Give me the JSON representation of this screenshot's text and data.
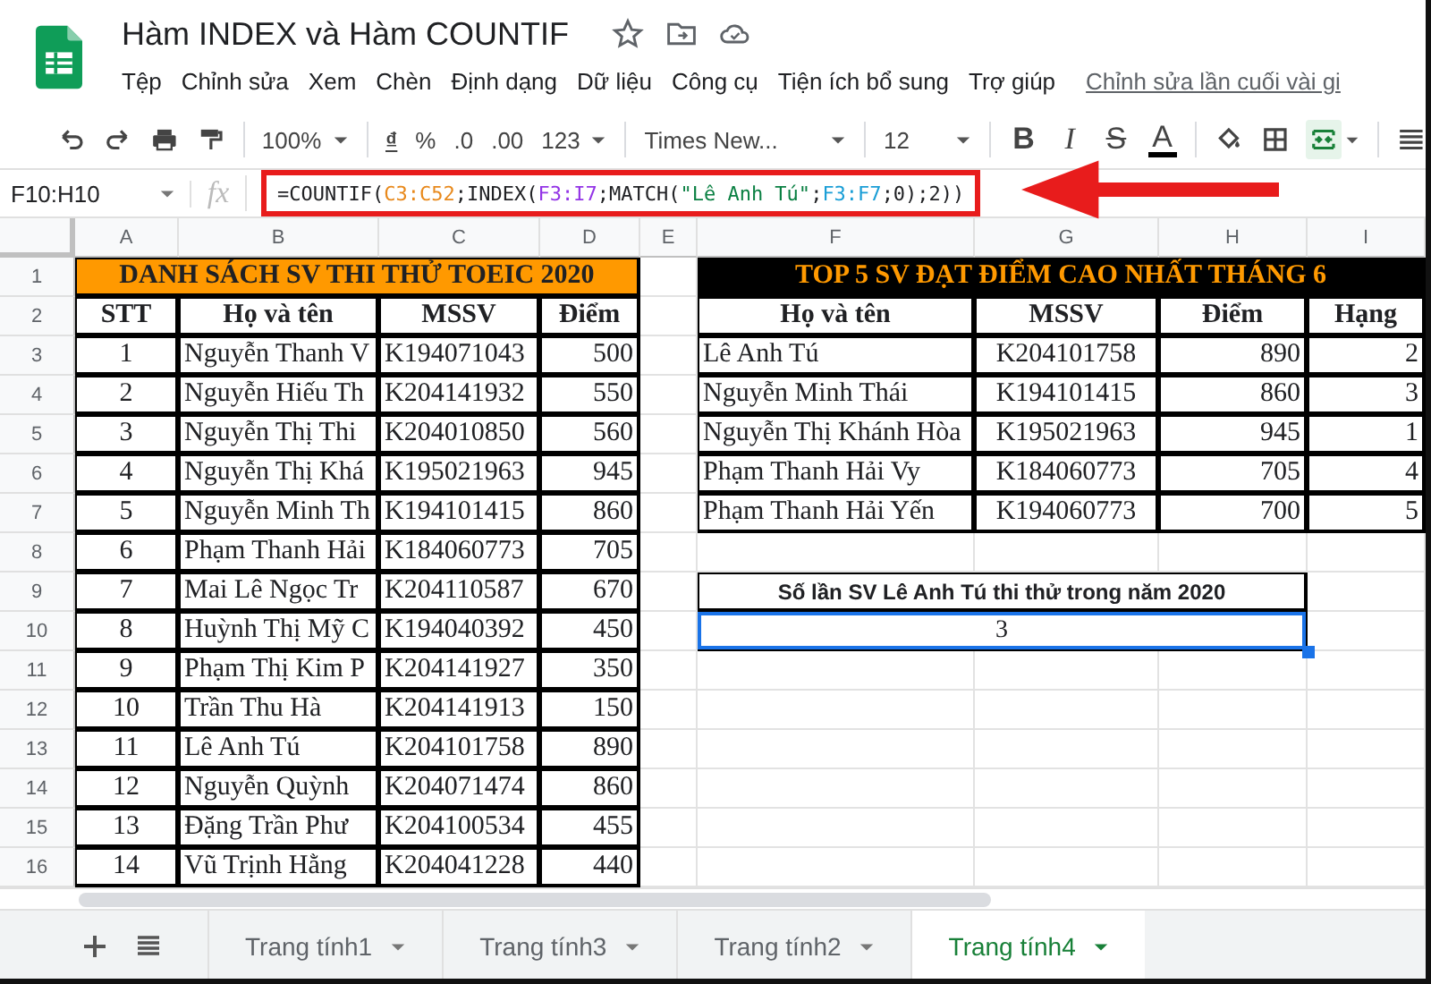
{
  "document": {
    "title": "Hàm INDEX và Hàm COUNTIF",
    "last_edit": "Chỉnh sửa lần cuối vài gi"
  },
  "menu": [
    "Tệp",
    "Chỉnh sửa",
    "Xem",
    "Chèn",
    "Định dạng",
    "Dữ liệu",
    "Công cụ",
    "Tiện ích bổ sung",
    "Trợ giúp"
  ],
  "toolbar": {
    "zoom": "100%",
    "currency": "₫",
    "percent": "%",
    "dec_less": ".0",
    "dec_more": ".00",
    "number_format": "123",
    "font": "Times New...",
    "font_size": "12",
    "bold": "B",
    "italic": "I",
    "strike": "S",
    "text_color": "A"
  },
  "formula_bar": {
    "name_box": "F10:H10",
    "fx": "fx",
    "parts": [
      {
        "text": "=COUNTIF(",
        "color": "#202124"
      },
      {
        "text": "C3:C52",
        "color": "#e8891c"
      },
      {
        "text": ";INDEX(",
        "color": "#202124"
      },
      {
        "text": "F3:I7",
        "color": "#9334e6"
      },
      {
        "text": ";MATCH(",
        "color": "#202124"
      },
      {
        "text": "\"Lê Anh Tú\"",
        "color": "#0b8043"
      },
      {
        "text": ";",
        "color": "#202124"
      },
      {
        "text": "F3:F7",
        "color": "#1a9ed6"
      },
      {
        "text": ";0);2))",
        "color": "#202124"
      }
    ]
  },
  "columns": [
    "A",
    "B",
    "C",
    "D",
    "E",
    "F",
    "G",
    "H",
    "I"
  ],
  "rows": [
    "1",
    "2",
    "3",
    "4",
    "5",
    "6",
    "7",
    "8",
    "9",
    "10",
    "11",
    "12",
    "13",
    "14",
    "15",
    "16"
  ],
  "left_table": {
    "title": "DANH SÁCH SV THI THỬ TOEIC 2020",
    "headers": [
      "STT",
      "Họ và tên",
      "MSSV",
      "Điểm"
    ],
    "rows": [
      [
        "1",
        "Nguyễn Thanh V",
        "K194071043",
        "500"
      ],
      [
        "2",
        "Nguyễn Hiếu Th",
        "K204141932",
        "550"
      ],
      [
        "3",
        "Nguyễn Thị Thi",
        "K204010850",
        "560"
      ],
      [
        "4",
        "Nguyễn Thị Khá",
        "K195021963",
        "945"
      ],
      [
        "5",
        "Nguyễn Minh Th",
        "K194101415",
        "860"
      ],
      [
        "6",
        "Phạm Thanh Hải",
        "K184060773",
        "705"
      ],
      [
        "7",
        "Mai Lê Ngọc Tr",
        "K204110587",
        "670"
      ],
      [
        "8",
        "Huỳnh Thị Mỹ C",
        "K194040392",
        "450"
      ],
      [
        "9",
        "Phạm Thị Kim P",
        "K204141927",
        "350"
      ],
      [
        "10",
        "Trần Thu Hà",
        "K204141913",
        "150"
      ],
      [
        "11",
        "Lê Anh Tú",
        "K204101758",
        "890"
      ],
      [
        "12",
        "Nguyễn Quỳnh",
        "K204071474",
        "860"
      ],
      [
        "13",
        "Đặng Trần Phư",
        "K204100534",
        "455"
      ],
      [
        "14",
        "Vũ Trịnh Hằng",
        "K204041228",
        "440"
      ]
    ]
  },
  "right_table": {
    "title": "TOP 5 SV ĐẠT ĐIỂM CAO NHẤT THÁNG 6",
    "headers": [
      "Họ và tên",
      "MSSV",
      "Điểm",
      "Hạng"
    ],
    "rows": [
      [
        "Lê Anh Tú",
        "K204101758",
        "890",
        "2"
      ],
      [
        "Nguyễn Minh Thái",
        "K194101415",
        "860",
        "3"
      ],
      [
        "Nguyễn Thị Khánh Hòa",
        "K195021963",
        "945",
        "1"
      ],
      [
        "Phạm Thanh Hải Vy",
        "K184060773",
        "705",
        "4"
      ],
      [
        "Phạm Thanh Hải Yến",
        "K194060773",
        "700",
        "5"
      ]
    ]
  },
  "count_box": {
    "label": "Số lần SV Lê Anh Tú thi thử trong năm 2020",
    "value": "3",
    "selected": true
  },
  "sheet_tabs": [
    {
      "label": "Trang tính1",
      "selected": false
    },
    {
      "label": "Trang tính3",
      "selected": false
    },
    {
      "label": "Trang tính2",
      "selected": false
    },
    {
      "label": "Trang tính4",
      "selected": true
    }
  ]
}
